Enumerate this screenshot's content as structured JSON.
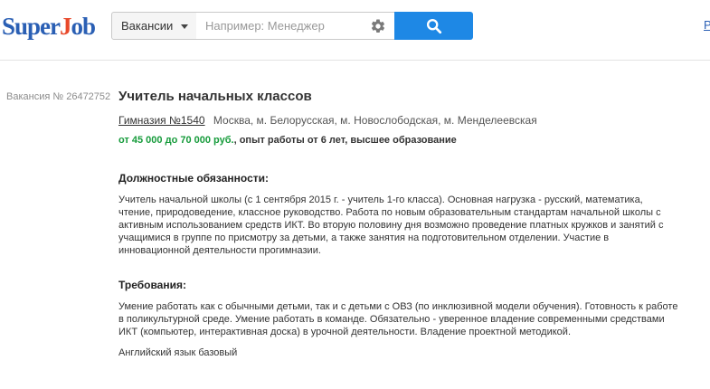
{
  "header": {
    "logo": {
      "part1": "Super",
      "part2": "J",
      "part3": "ob"
    },
    "search_type": "Вакансии",
    "search_placeholder": "Например: Менеджер",
    "right_link": "Р"
  },
  "vacancy": {
    "number": "Вакансия № 26472752",
    "title": "Учитель начальных классов",
    "company": "Гимназия №1540",
    "location": "Москва, м. Белорусская, м. Новослободская, м. Менделеевская",
    "salary": "от 45 000 до 70 000 руб.",
    "conditions": ", опыт работы от 6 лет, высшее образование",
    "duties_title": "Должностные обязанности:",
    "duties_text": "Учитель начальной школы (с 1 сентября 2015 г. - учитель 1-го класса). Основная нагрузка - русский, математика, чтение, природоведение, классное руководство. Работа по новым образовательным стандартам начальной школы с активным использованием средств ИКТ. Во вторую половину дня возможно проведение платных кружков и занятий с учащимися в группе по присмотру за детьми, а также занятия на подготовительном отделении. Участие в инновационной деятельности прогимназии.",
    "req_title": "Требования:",
    "req_text": "Умение работать как с обычными детьми, так и с детьми с ОВЗ (по инклюзивной модели обучения). Готовность к работе в поликультурной среде. Умение работать в команде. Обязательно - уверенное владение современными средствами ИКТ (компьютер, интерактивная доска) в урочной деятельности. Владение проектной методикой.",
    "req_extra": "Английский язык базовый"
  },
  "colors": {
    "brand_blue": "#2a5fb4",
    "brand_red": "#e8492b",
    "search_button": "#1e88e5",
    "salary_green": "#169b3b"
  },
  "icons": {
    "settings": "gear-icon",
    "search": "search-icon",
    "dropdown": "caret-down-icon"
  }
}
